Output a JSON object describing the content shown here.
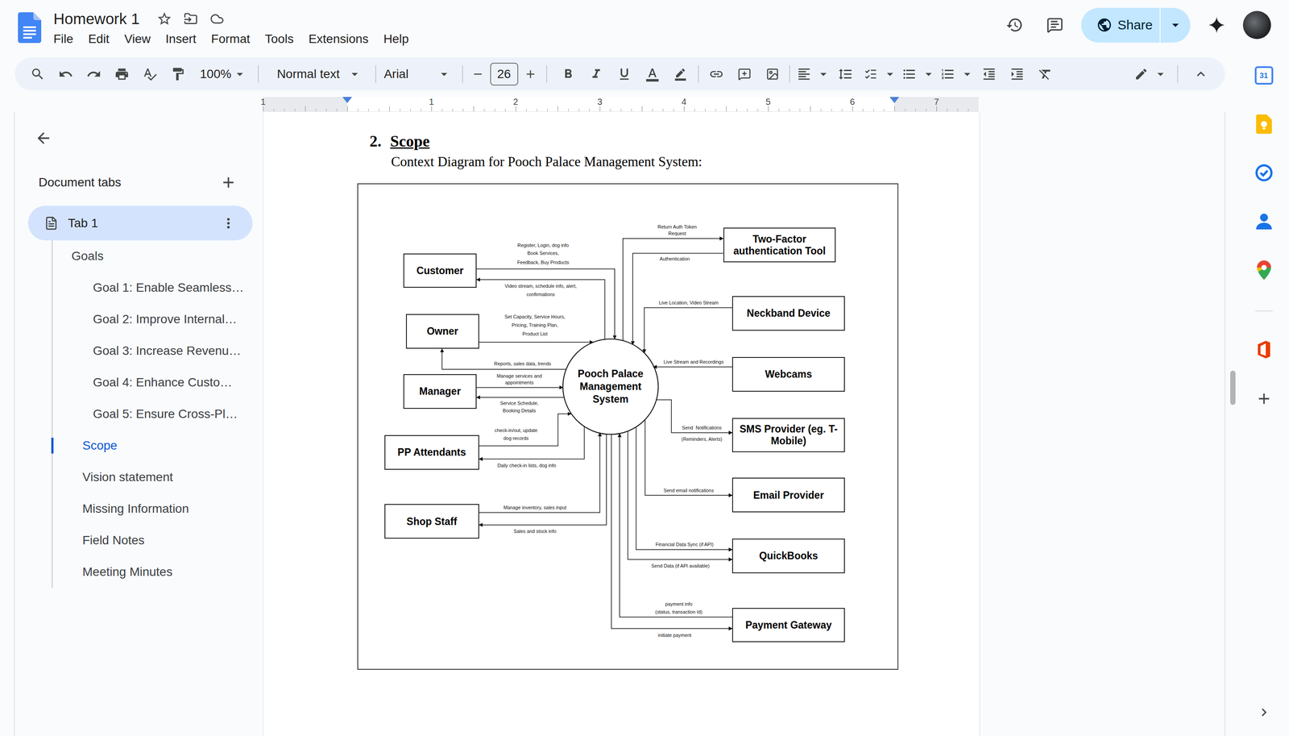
{
  "app": {
    "title": "Homework 1",
    "starred": false,
    "menu": [
      "File",
      "Edit",
      "View",
      "Insert",
      "Format",
      "Tools",
      "Extensions",
      "Help"
    ],
    "share_label": "Share"
  },
  "toolbar": {
    "zoom": "100%",
    "paragraph_style": "Normal text",
    "font": "Arial",
    "font_size": "26"
  },
  "ruler": {
    "labels": [
      "1",
      "1",
      "2",
      "3",
      "4",
      "5",
      "6",
      "7"
    ]
  },
  "side_panel": {
    "title": "Document tabs",
    "tabs": [
      {
        "label": "Tab 1",
        "selected": true
      }
    ],
    "outline": [
      {
        "label": "Goals",
        "level": 1,
        "selected": false
      },
      {
        "label": "Goal 1: Enable Seamless…",
        "level": 3,
        "selected": false
      },
      {
        "label": "Goal 2: Improve Internal…",
        "level": 3,
        "selected": false
      },
      {
        "label": "Goal 3: Increase Revenu…",
        "level": 3,
        "selected": false
      },
      {
        "label": "Goal 4: Enhance Custo…",
        "level": 3,
        "selected": false
      },
      {
        "label": "Goal 5: Ensure Cross-Pl…",
        "level": 3,
        "selected": false
      },
      {
        "label": "Scope",
        "level": 2,
        "selected": true
      },
      {
        "label": "Vision statement",
        "level": 2,
        "selected": false
      },
      {
        "label": "Missing Information",
        "level": 2,
        "selected": false
      },
      {
        "label": "Field Notes",
        "level": 2,
        "selected": false
      },
      {
        "label": "Meeting Minutes",
        "level": 2,
        "selected": false
      }
    ]
  },
  "page": {
    "section_number": "2.",
    "section_title": "Scope",
    "caption": "Context Diagram for Pooch Palace Management System:",
    "diagram": {
      "process": "Pooch Palace Management System",
      "entities": [
        {
          "label": "Customer",
          "flows": [
            {
              "direction": "to-system",
              "labels": [
                "Register, Login, dog info",
                "Book Services,",
                "Feedback, Buy Products"
              ]
            },
            {
              "direction": "from-system",
              "labels": [
                "Video stream, schedule info, alert,",
                "confirmations"
              ]
            }
          ]
        },
        {
          "label": "Owner",
          "flows": [
            {
              "direction": "to-system",
              "labels": [
                "Set Capacity, Service Hours,",
                "Pricing, Training Plan,",
                "Product List"
              ]
            },
            {
              "direction": "from-system",
              "labels": [
                "Reports, sales data, trends"
              ]
            }
          ]
        },
        {
          "label": "Manager",
          "flows": [
            {
              "direction": "to-system",
              "labels": [
                "Manage services and",
                "appointments"
              ]
            },
            {
              "direction": "from-system",
              "labels": [
                "Service Schedule,",
                "Booking Details"
              ]
            }
          ]
        },
        {
          "label": "PP Attendants",
          "flows": [
            {
              "direction": "to-system",
              "labels": [
                "check-in/out, update",
                "dog records"
              ]
            },
            {
              "direction": "from-system",
              "labels": [
                "Daily check-in lists, dog info"
              ]
            }
          ]
        },
        {
          "label": "Shop Staff",
          "flows": [
            {
              "direction": "to-system",
              "labels": [
                "Manage inventory, sales input"
              ]
            },
            {
              "direction": "from-system",
              "labels": [
                "Sales and stock info"
              ]
            }
          ]
        },
        {
          "label": "Two-Factor authentication Tool",
          "flows": [
            {
              "direction": "from-system",
              "labels": [
                "Return Auth Token",
                "Request"
              ]
            },
            {
              "direction": "to-system",
              "labels": [
                "Authentication"
              ]
            }
          ]
        },
        {
          "label": "Neckband Device",
          "flows": [
            {
              "direction": "to-system",
              "labels": [
                "Live Location, Video Stream"
              ]
            }
          ]
        },
        {
          "label": "Webcams",
          "flows": [
            {
              "direction": "to-system",
              "labels": [
                "Live Stream and Recordings"
              ]
            }
          ]
        },
        {
          "label": "SMS Provider (eg. T-Mobile)",
          "flows": [
            {
              "direction": "from-system",
              "labels": [
                "Send  Notifications",
                "(Reminders, Alerts)"
              ]
            }
          ]
        },
        {
          "label": "Email Provider",
          "flows": [
            {
              "direction": "from-system",
              "labels": [
                "Send email notifications"
              ]
            }
          ]
        },
        {
          "label": "QuickBooks",
          "flows": [
            {
              "direction": "from-system",
              "labels": [
                "Financial Data Sync (if API)"
              ]
            },
            {
              "direction": "from-system",
              "labels": [
                "Send Data (if API available)"
              ]
            }
          ]
        },
        {
          "label": "Payment Gateway",
          "flows": [
            {
              "direction": "to-system",
              "labels": [
                "payment info",
                "(status, transaction Id)"
              ]
            },
            {
              "direction": "from-system",
              "labels": [
                "initiate payment"
              ]
            }
          ]
        }
      ]
    }
  },
  "side_rail": {
    "calendar_day": "31"
  },
  "scrollbar": {
    "level": 0.49
  }
}
